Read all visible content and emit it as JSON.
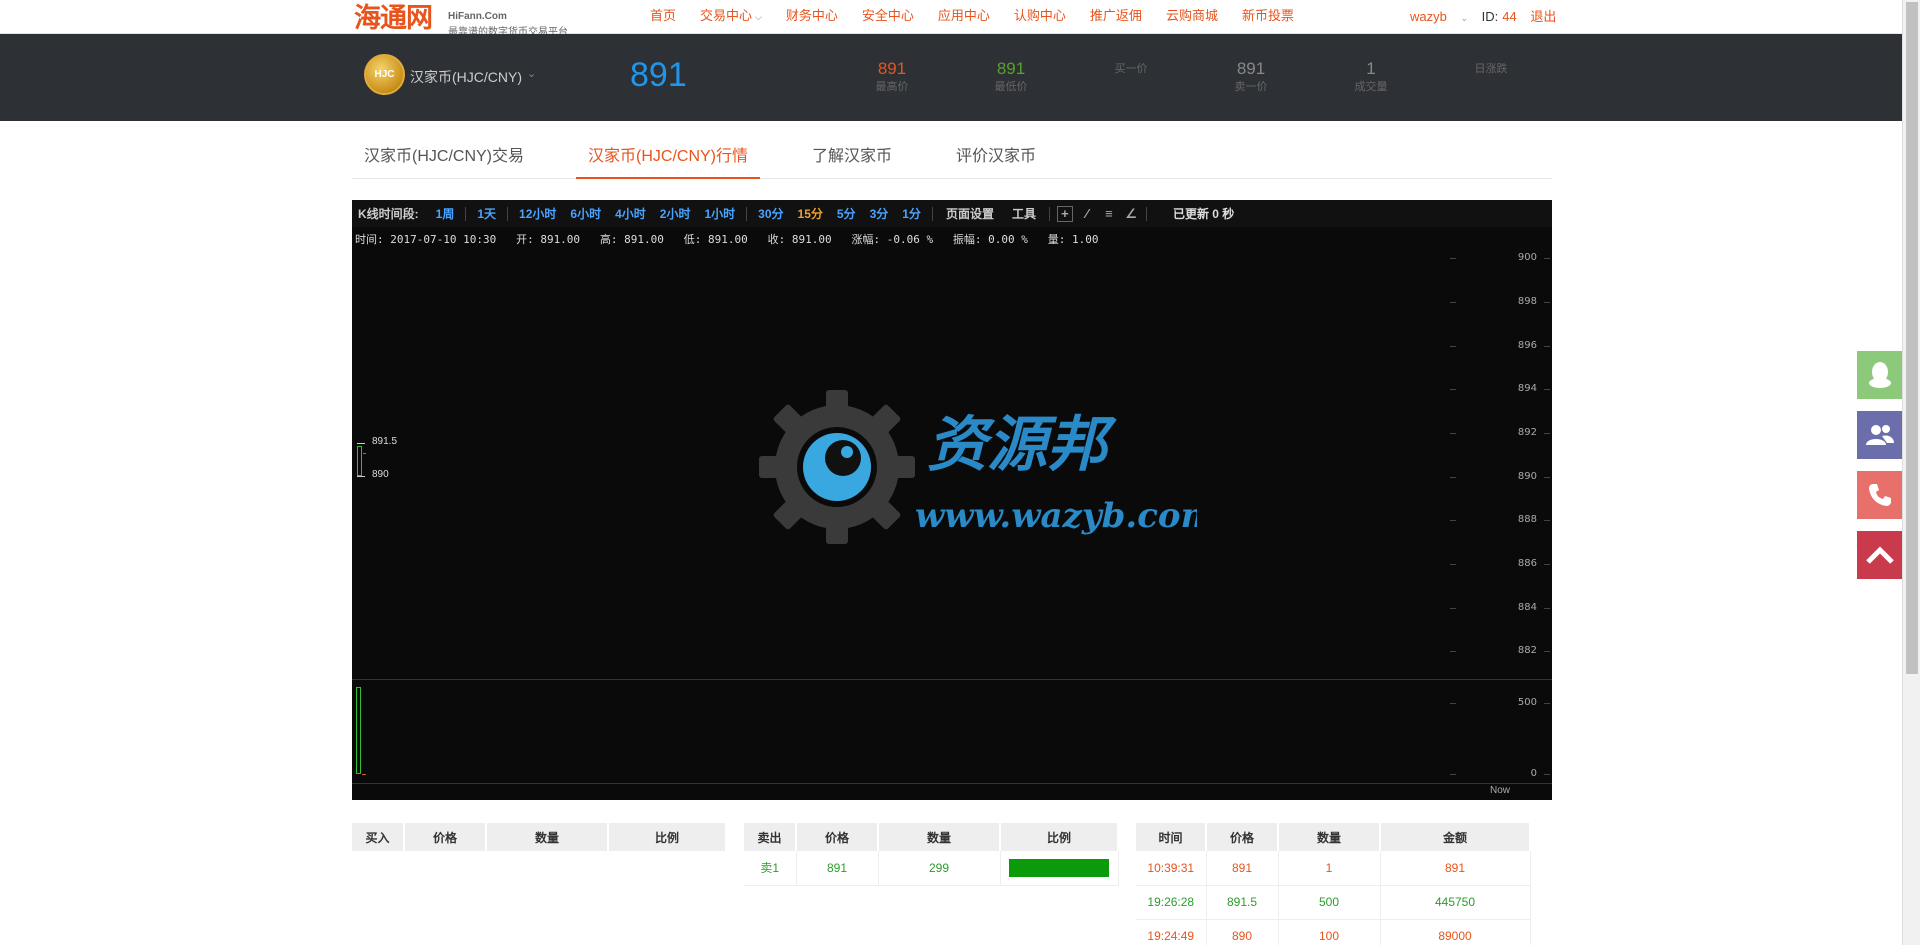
{
  "topbar": {
    "logo_main": "海通网",
    "logo_site": "HiFann.Com",
    "logo_slogan": "最靠谱的数字货币交易平台",
    "nav": [
      "首页",
      "交易中心",
      "财务中心",
      "安全中心",
      "应用中心",
      "认购中心",
      "推广返佣",
      "云购商城",
      "新币投票"
    ],
    "username": "wazyb",
    "id_label": "ID:",
    "id_value": "44",
    "logout": "退出"
  },
  "header": {
    "coin_badge": "HJC",
    "coin_name": "汉家币(HJC/CNY)",
    "price": "891",
    "stats": [
      {
        "value": "891",
        "label": "最高价",
        "color": "#e8541c"
      },
      {
        "value": "891",
        "label": "最低价",
        "color": "#5aa02c"
      },
      {
        "value": "",
        "label": "买一价",
        "color": "#888888"
      },
      {
        "value": "891",
        "label": "卖一价",
        "color": "#888888"
      },
      {
        "value": "1",
        "label": "成交量",
        "color": "#888888"
      },
      {
        "value": "",
        "label": "日涨跌",
        "color": "#888888"
      }
    ]
  },
  "tabs": [
    "汉家币(HJC/CNY)交易",
    "汉家币(HJC/CNY)行情",
    "了解汉家币",
    "评价汉家币"
  ],
  "kline": {
    "period_label": "K线时间段:",
    "periods": [
      "1周",
      "1天",
      "12小时",
      "6小时",
      "4小时",
      "2小时",
      "1小时",
      "30分",
      "15分",
      "5分",
      "3分",
      "1分"
    ],
    "active_period": "15分",
    "menu": [
      "页面设置",
      "工具"
    ],
    "updated": "已更新 0 秒",
    "info": "时间: 2017-07-10 10:30   开: 891.00   高: 891.00   低: 891.00   收: 891.00   涨幅: -0.06 %   振幅: 0.00 %   量: 1.00",
    "price_axis": [
      "900",
      "898",
      "896",
      "894",
      "892",
      "890",
      "888",
      "886",
      "884",
      "882"
    ],
    "volume_axis": [
      "500",
      "0"
    ],
    "now_label": "Now",
    "high_mark": "891.5",
    "low_mark": "890",
    "watermark_title": "资源邦",
    "watermark_url": "www.wazyb.com"
  },
  "buy_table": {
    "headers": [
      "买入",
      "价格",
      "数量",
      "比例"
    ]
  },
  "sell_table": {
    "headers": [
      "卖出",
      "价格",
      "数量",
      "比例"
    ],
    "rows": [
      {
        "label": "卖1",
        "price": "891",
        "qty": "299",
        "ratio": 1.0
      }
    ]
  },
  "trade_table": {
    "headers": [
      "时间",
      "价格",
      "数量",
      "金额"
    ],
    "rows": [
      {
        "time": "10:39:31",
        "price": "891",
        "qty": "1",
        "amount": "891",
        "color": "#e8541c"
      },
      {
        "time": "19:26:28",
        "price": "891.5",
        "qty": "500",
        "amount": "445750",
        "color": "#2e9b2e"
      },
      {
        "time": "19:24:49",
        "price": "890",
        "qty": "100",
        "amount": "89000",
        "color": "#e8541c"
      }
    ]
  },
  "side_buttons": [
    {
      "icon": "qq-icon",
      "color": "#8cc97a"
    },
    {
      "icon": "users-icon",
      "color": "#6b6eab"
    },
    {
      "icon": "phone-icon",
      "color": "#e8706b"
    },
    {
      "icon": "arrow-up-icon",
      "color": "#c93a4c"
    }
  ]
}
